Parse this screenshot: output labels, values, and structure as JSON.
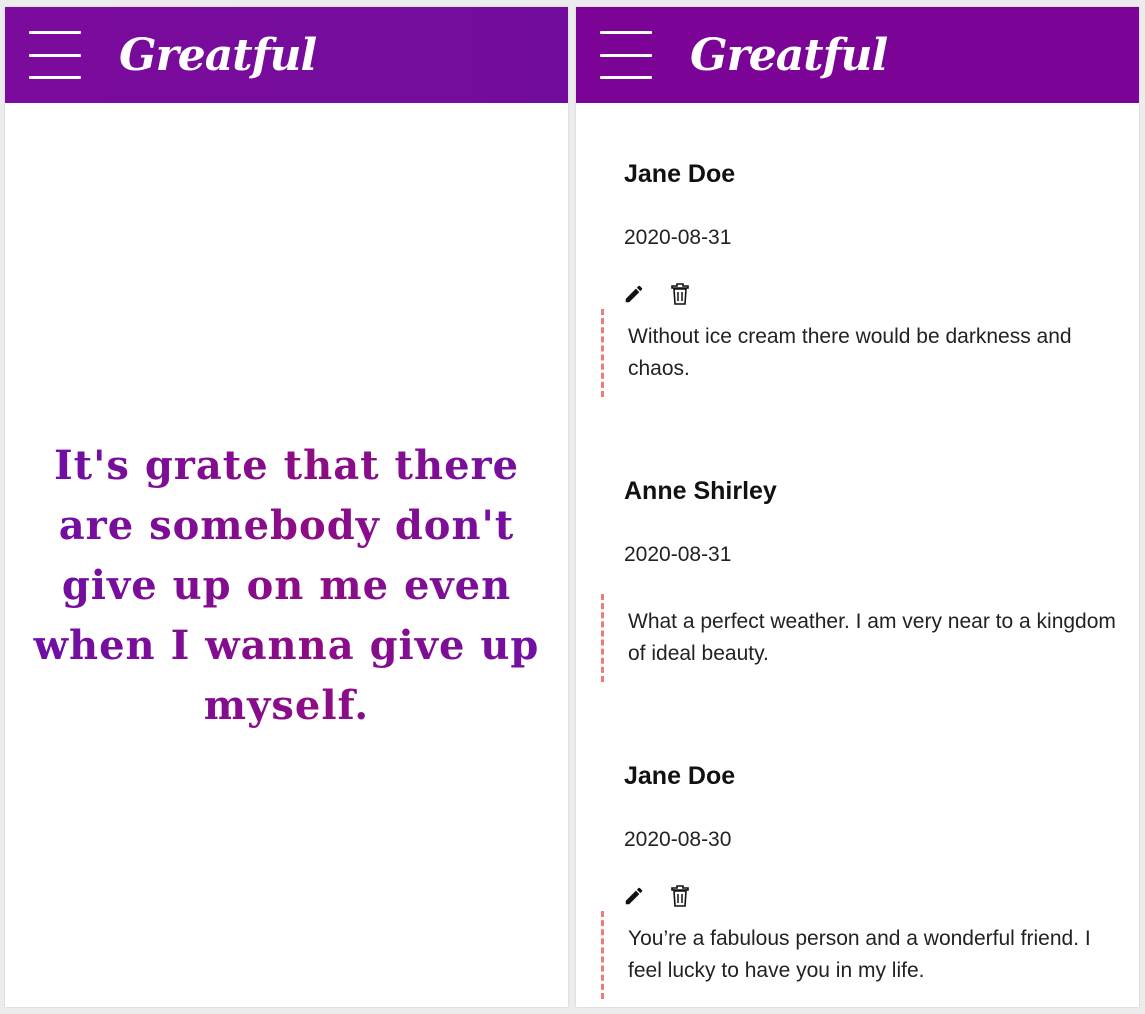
{
  "brand": "Greatful",
  "quote": "It's grate that there are somebody don't give up on me even when I wanna give up myself.",
  "entries": [
    {
      "name": "Jane Doe",
      "date": "2020-08-31",
      "text": "Without ice cream there would be darkness and chaos.",
      "editable": true
    },
    {
      "name": "Anne Shirley",
      "date": "2020-08-31",
      "text": "What a perfect weather. I am very near to a kingdom of ideal beauty.",
      "editable": false
    },
    {
      "name": "Jane Doe",
      "date": "2020-08-30",
      "text": "You’re a fabulous person and a wonderful friend. I feel lucky to have you in my life.",
      "editable": true
    }
  ],
  "colors": {
    "appbar": "#7b0396",
    "quote_gradient_start": "#6d0ea8",
    "quote_gradient_end": "#8e0c84",
    "divider": "#f07a7a"
  },
  "icons": [
    "menu-icon",
    "pencil-icon",
    "trash-icon"
  ]
}
